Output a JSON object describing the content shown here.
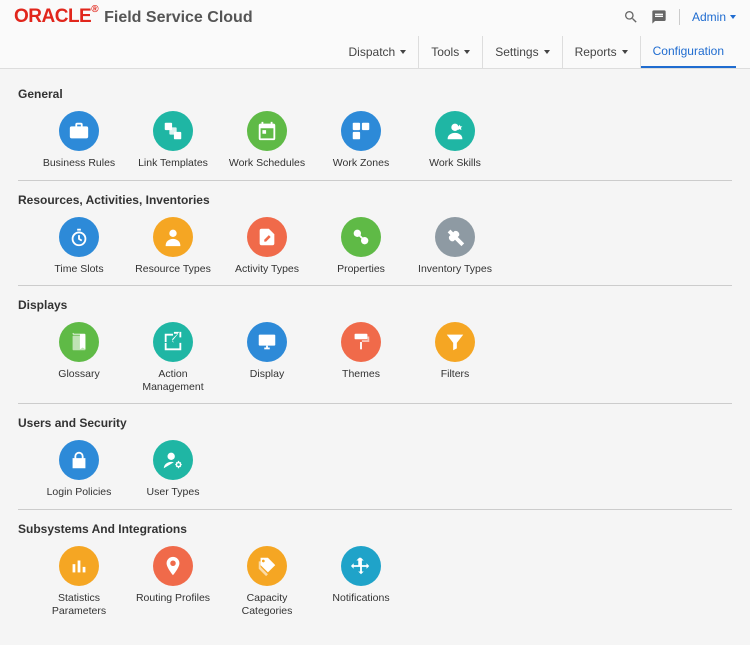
{
  "brand": {
    "logo": "ORACLE",
    "product": "Field Service Cloud"
  },
  "user": {
    "label": "Admin"
  },
  "nav": {
    "dispatch": "Dispatch",
    "tools": "Tools",
    "settings": "Settings",
    "reports": "Reports",
    "configuration": "Configuration"
  },
  "colors": {
    "blue": "#2d8ad8",
    "teal": "#1fb6a4",
    "green": "#5fba46",
    "orange": "#f5a623",
    "coral": "#f06a4a",
    "gray": "#8e9aa3",
    "cyan": "#1fa3c9"
  },
  "sections": {
    "general": {
      "title": "General",
      "business_rules": "Business Rules",
      "link_templates": "Link Templates",
      "work_schedules": "Work Schedules",
      "work_zones": "Work Zones",
      "work_skills": "Work Skills"
    },
    "resources": {
      "title": "Resources, Activities, Inventories",
      "time_slots": "Time Slots",
      "resource_types": "Resource Types",
      "activity_types": "Activity Types",
      "properties": "Properties",
      "inventory_types": "Inventory Types"
    },
    "displays": {
      "title": "Displays",
      "glossary": "Glossary",
      "action_management": "Action Management",
      "display": "Display",
      "themes": "Themes",
      "filters": "Filters"
    },
    "users": {
      "title": "Users and Security",
      "login_policies": "Login Policies",
      "user_types": "User Types"
    },
    "subsystems": {
      "title": "Subsystems And Integrations",
      "statistics_parameters": "Statistics Parameters",
      "routing_profiles": "Routing Profiles",
      "capacity_categories": "Capacity Categories",
      "notifications": "Notifications"
    }
  }
}
